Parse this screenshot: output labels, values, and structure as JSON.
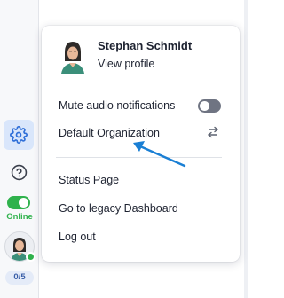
{
  "profile": {
    "name": "Stephan Schmidt",
    "view_profile": "View profile"
  },
  "menu": {
    "mute_audio": "Mute audio notifications",
    "mute_audio_enabled": false,
    "organization": "Default Organization",
    "status_page": "Status Page",
    "legacy_dashboard": "Go to legacy Dashboard",
    "logout": "Log out"
  },
  "rail": {
    "online_label": "Online",
    "online_enabled": true,
    "counter": "0/5"
  },
  "colors": {
    "accent": "#1a7fd4",
    "online": "#2fb24c",
    "settings_active_bg": "#d9e6fb"
  },
  "icons": [
    "settings-gear-icon",
    "help-question-icon",
    "switch-organization-icon",
    "pointer-arrow"
  ]
}
